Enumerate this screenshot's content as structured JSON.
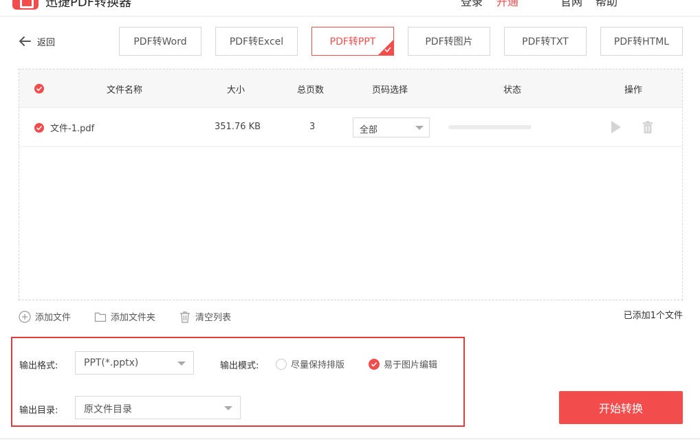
{
  "app": {
    "title": "迅捷PDF转换器",
    "right_items": [
      "登录",
      "开通",
      "官网",
      "帮助"
    ]
  },
  "nav": {
    "back_label": "返回"
  },
  "tabs": [
    {
      "label": "PDF转Word",
      "active": false
    },
    {
      "label": "PDF转Excel",
      "active": false
    },
    {
      "label": "PDF转PPT",
      "active": true
    },
    {
      "label": "PDF转图片",
      "active": false
    },
    {
      "label": "PDF转TXT",
      "active": false
    },
    {
      "label": "PDF转HTML",
      "active": false
    }
  ],
  "table": {
    "headers": {
      "name": "文件名称",
      "size": "大小",
      "pages": "总页数",
      "page_select": "页码选择",
      "status": "状态",
      "actions": "操作"
    },
    "rows": [
      {
        "name": "文件-1.pdf",
        "size": "351.76 KB",
        "pages": "3",
        "page_select": "全部",
        "progress": 0
      }
    ]
  },
  "actions": {
    "add_file": "添加文件",
    "add_folder": "添加文件夹",
    "clear_list": "清空列表"
  },
  "file_count": "已添加1个文件",
  "output": {
    "format_label": "输出格式:",
    "format_value": "PPT(*.pptx)",
    "mode_label": "输出模式:",
    "mode_options": [
      {
        "label": "尽量保持排版",
        "selected": false
      },
      {
        "label": "易于图片编辑",
        "selected": true
      }
    ],
    "dir_label": "输出目录:",
    "dir_value": "原文件目录"
  },
  "start_button": "开始转换",
  "colors": {
    "accent": "#f24c4c",
    "highlight_border": "#e4393c"
  }
}
